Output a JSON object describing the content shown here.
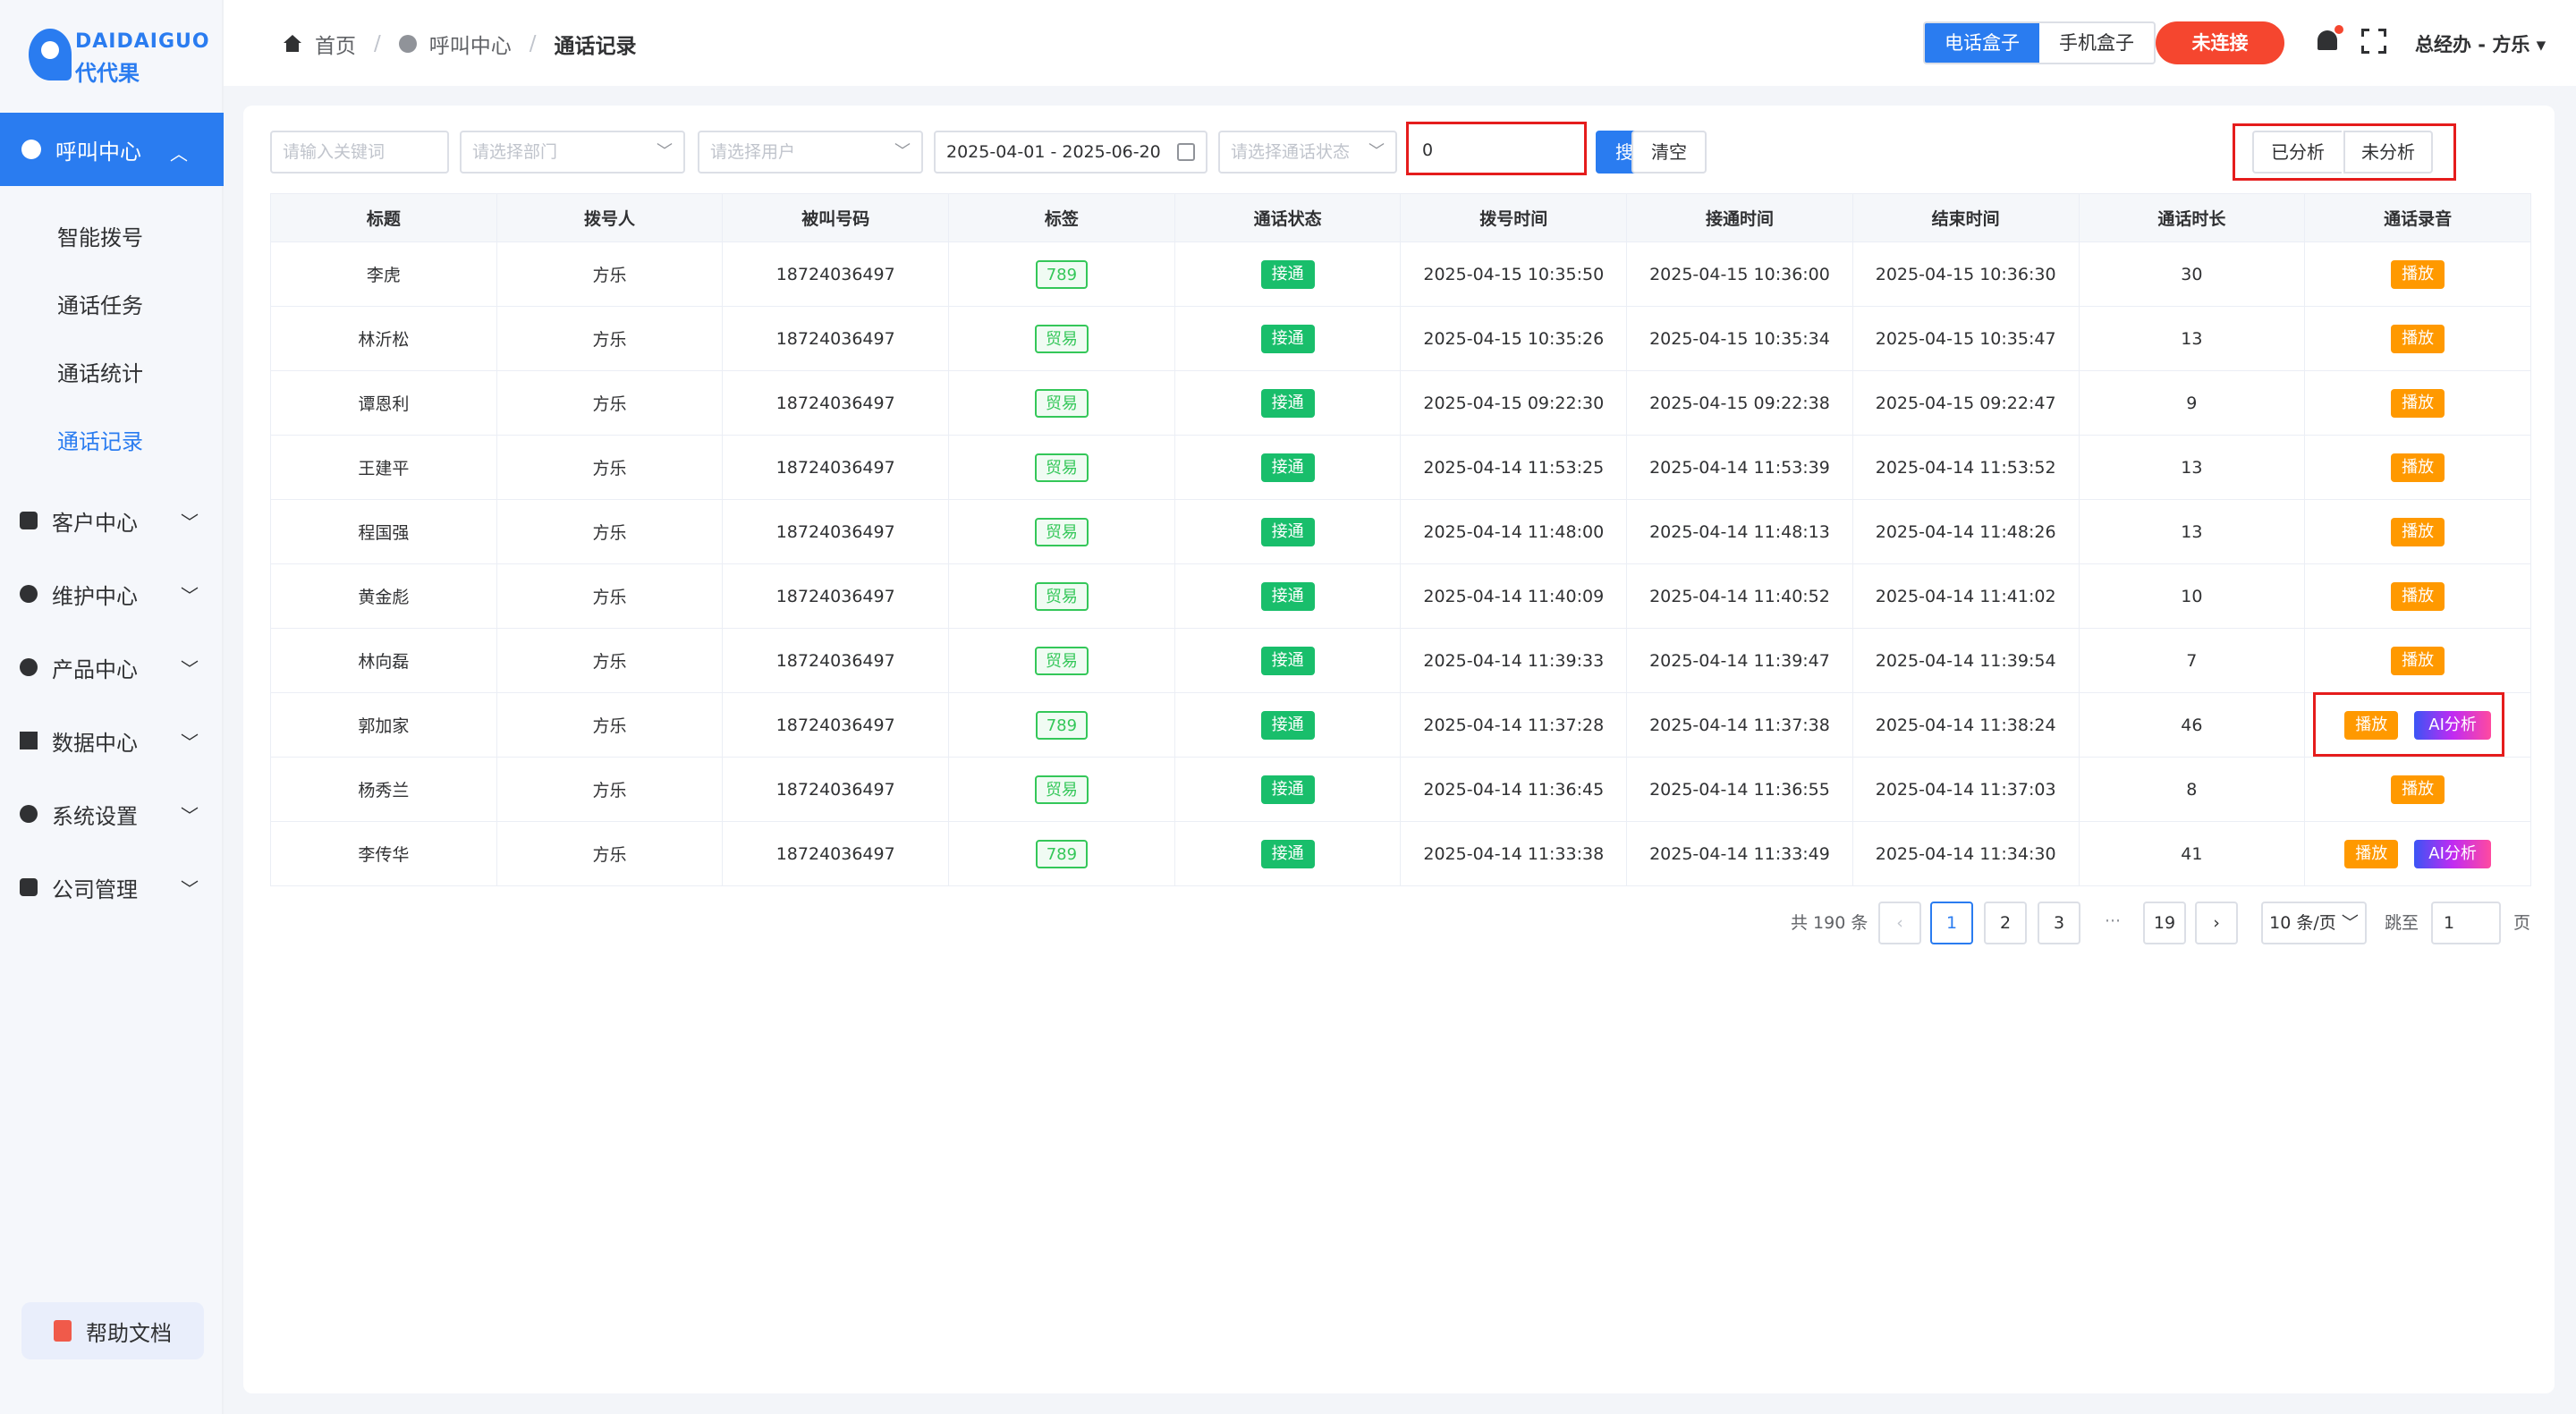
{
  "logo": {
    "en": "DAIDAIGUO",
    "cn": "代代果"
  },
  "sidebar": {
    "active_group": "呼叫中心",
    "sub_items": [
      "智能拨号",
      "通话任务",
      "通话统计",
      "通话记录"
    ],
    "groups": [
      "客户中心",
      "维护中心",
      "产品中心",
      "数据中心",
      "系统设置",
      "公司管理"
    ],
    "help": "帮助文档"
  },
  "header": {
    "breadcrumb": [
      "首页",
      "呼叫中心",
      "通话记录"
    ],
    "device_tabs": [
      "电话盒子",
      "手机盒子"
    ],
    "connection_button": "未连接",
    "user": "总经办 - 方乐"
  },
  "filters": {
    "keyword_placeholder": "请输入关键词",
    "department_placeholder": "请选择部门",
    "user_placeholder": "请选择用户",
    "date_range": "2025-04-01 - 2025-06-20",
    "status_placeholder": "请选择通话状态",
    "number_value": "0",
    "search_label": "搜索",
    "clear_label": "清空",
    "analysis_tabs": [
      "已分析",
      "未分析"
    ]
  },
  "table": {
    "headers": [
      "标题",
      "拨号人",
      "被叫号码",
      "标签",
      "通话状态",
      "拨号时间",
      "接通时间",
      "结束时间",
      "通话时长",
      "通话录音"
    ],
    "rows": [
      {
        "title": "李虎",
        "caller": "方乐",
        "number": "18724036497",
        "tag": "789",
        "status": "接通",
        "dial": "2025-04-15 10:35:50",
        "connect": "2025-04-15 10:36:00",
        "end": "2025-04-15 10:36:30",
        "duration": "30",
        "play": "播放",
        "ai": ""
      },
      {
        "title": "林沂松",
        "caller": "方乐",
        "number": "18724036497",
        "tag": "贸易",
        "status": "接通",
        "dial": "2025-04-15 10:35:26",
        "connect": "2025-04-15 10:35:34",
        "end": "2025-04-15 10:35:47",
        "duration": "13",
        "play": "播放",
        "ai": ""
      },
      {
        "title": "谭恩利",
        "caller": "方乐",
        "number": "18724036497",
        "tag": "贸易",
        "status": "接通",
        "dial": "2025-04-15 09:22:30",
        "connect": "2025-04-15 09:22:38",
        "end": "2025-04-15 09:22:47",
        "duration": "9",
        "play": "播放",
        "ai": ""
      },
      {
        "title": "王建平",
        "caller": "方乐",
        "number": "18724036497",
        "tag": "贸易",
        "status": "接通",
        "dial": "2025-04-14 11:53:25",
        "connect": "2025-04-14 11:53:39",
        "end": "2025-04-14 11:53:52",
        "duration": "13",
        "play": "播放",
        "ai": ""
      },
      {
        "title": "程国强",
        "caller": "方乐",
        "number": "18724036497",
        "tag": "贸易",
        "status": "接通",
        "dial": "2025-04-14 11:48:00",
        "connect": "2025-04-14 11:48:13",
        "end": "2025-04-14 11:48:26",
        "duration": "13",
        "play": "播放",
        "ai": ""
      },
      {
        "title": "黄金彪",
        "caller": "方乐",
        "number": "18724036497",
        "tag": "贸易",
        "status": "接通",
        "dial": "2025-04-14 11:40:09",
        "connect": "2025-04-14 11:40:52",
        "end": "2025-04-14 11:41:02",
        "duration": "10",
        "play": "播放",
        "ai": ""
      },
      {
        "title": "林向磊",
        "caller": "方乐",
        "number": "18724036497",
        "tag": "贸易",
        "status": "接通",
        "dial": "2025-04-14 11:39:33",
        "connect": "2025-04-14 11:39:47",
        "end": "2025-04-14 11:39:54",
        "duration": "7",
        "play": "播放",
        "ai": ""
      },
      {
        "title": "郭加家",
        "caller": "方乐",
        "number": "18724036497",
        "tag": "789",
        "status": "接通",
        "dial": "2025-04-14 11:37:28",
        "connect": "2025-04-14 11:37:38",
        "end": "2025-04-14 11:38:24",
        "duration": "46",
        "play": "播放",
        "ai": "AI分析"
      },
      {
        "title": "杨秀兰",
        "caller": "方乐",
        "number": "18724036497",
        "tag": "贸易",
        "status": "接通",
        "dial": "2025-04-14 11:36:45",
        "connect": "2025-04-14 11:36:55",
        "end": "2025-04-14 11:37:03",
        "duration": "8",
        "play": "播放",
        "ai": ""
      },
      {
        "title": "李传华",
        "caller": "方乐",
        "number": "18724036497",
        "tag": "789",
        "status": "接通",
        "dial": "2025-04-14 11:33:38",
        "connect": "2025-04-14 11:33:49",
        "end": "2025-04-14 11:34:30",
        "duration": "41",
        "play": "播放",
        "ai": "AI分析"
      }
    ]
  },
  "pagination": {
    "total": "共 190 条",
    "pages": [
      "1",
      "2",
      "3",
      "···",
      "19"
    ],
    "prev": "‹",
    "next": "›",
    "page_size": "10 条/页",
    "goto_label": "跳至",
    "goto_value": "1",
    "page_suffix": "页"
  },
  "colors": {
    "primary": "#2a7cf0",
    "danger": "#f5462f",
    "success": "#19be6b",
    "warning": "#ff9900",
    "highlight": "#e51c1c"
  }
}
